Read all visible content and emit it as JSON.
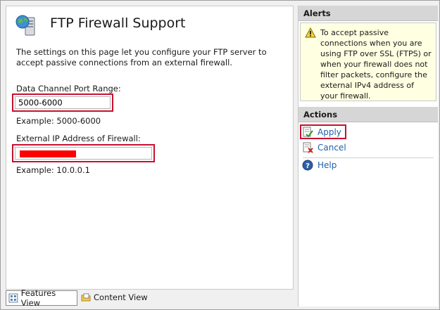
{
  "main": {
    "title": "FTP Firewall Support",
    "description": "The settings on this page let you configure your FTP server to accept passive connections from an external firewall.",
    "port_range": {
      "label": "Data Channel Port Range:",
      "value": "5000-6000",
      "example": "Example: 5000-6000"
    },
    "external_ip": {
      "label": "External IP Address of Firewall:",
      "value": "",
      "example": "Example: 10.0.0.1"
    }
  },
  "tabs": {
    "features_view": "Features View",
    "content_view": "Content View"
  },
  "alerts": {
    "header": "Alerts",
    "message": "To accept passive connections when you are using FTP over SSL (FTPS) or when your firewall does not filter packets, configure the external IPv4 address of your firewall."
  },
  "actions": {
    "header": "Actions",
    "apply": "Apply",
    "cancel": "Cancel",
    "help": "Help"
  },
  "colors": {
    "highlight": "#c8102e",
    "link": "#1f5fad",
    "alert_background": "#ffffe1"
  }
}
